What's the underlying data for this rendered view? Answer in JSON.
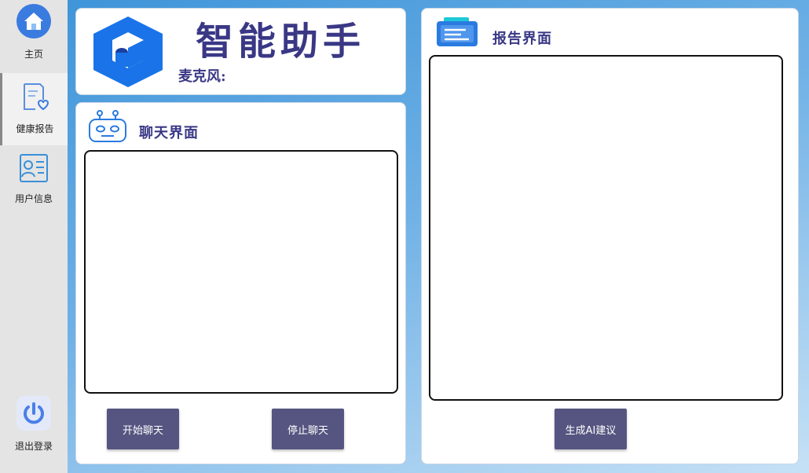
{
  "sidebar": {
    "items": [
      {
        "label": "主页",
        "icon": "home-icon"
      },
      {
        "label": "健康报告",
        "icon": "health-report-icon"
      },
      {
        "label": "用户信息",
        "icon": "user-info-icon"
      }
    ],
    "logout": {
      "label": "退出登录",
      "icon": "power-icon"
    }
  },
  "header": {
    "title": "智能助手",
    "mic_label": "麦克风:"
  },
  "chat": {
    "title": "聊天界面",
    "start_button": "开始聊天",
    "stop_button": "停止聊天"
  },
  "report": {
    "title": "报告界面",
    "generate_button": "生成AI建议"
  },
  "colors": {
    "accent": "#3a3885",
    "button": "#565581",
    "logo_blue": "#1a73e8"
  }
}
